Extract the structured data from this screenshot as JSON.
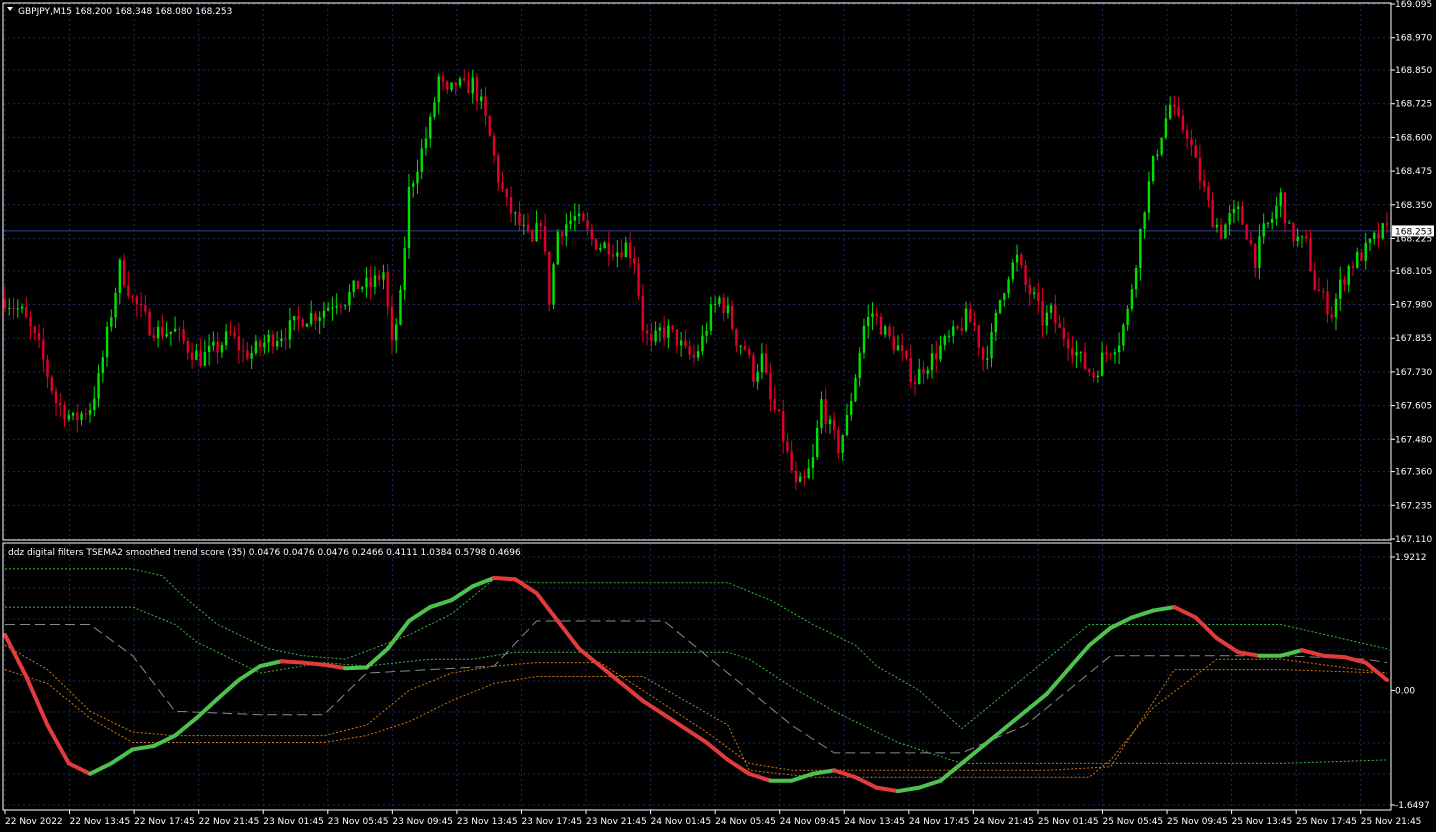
{
  "main_window": {
    "title": "GBPJPY,M15  168.200 168.348 168.080 168.253",
    "current_price": "168.253"
  },
  "indicator_window": {
    "title": "ddz digital filters TSEMA2 smoothed trend score (35) 0.0476 0.0476 0.0476 0.2466 0.4111 1.0384 0.5798 0.4696"
  },
  "colors": {
    "background": "#000000",
    "grid": "#1f2a5c",
    "frame": "#ffffff",
    "bull_candle": "#00e000",
    "bear_candle": "#e0002a",
    "score_up": "#4ec24e",
    "score_down": "#e23b3b",
    "band_green": "#3fb83f",
    "band_orange": "#d07a10",
    "band_gray": "#8a8a8a",
    "price_line": "#2f3f9a"
  },
  "chart_data": [
    {
      "type": "candlestick",
      "symbol": "GBPJPY",
      "timeframe": "M15",
      "ylim": [
        167.11,
        169.095
      ],
      "y_ticks": [
        "169.095",
        "168.970",
        "168.850",
        "168.725",
        "168.600",
        "168.475",
        "168.350",
        "168.225",
        "168.105",
        "167.980",
        "167.855",
        "167.730",
        "167.605",
        "167.480",
        "167.360",
        "167.235",
        "167.110"
      ],
      "x_ticks": [
        "22 Nov 2022",
        "22 Nov 13:45",
        "22 Nov 17:45",
        "22 Nov 21:45",
        "23 Nov 01:45",
        "23 Nov 05:45",
        "23 Nov 09:45",
        "23 Nov 13:45",
        "23 Nov 17:45",
        "23 Nov 21:45",
        "24 Nov 01:45",
        "24 Nov 05:45",
        "24 Nov 09:45",
        "24 Nov 13:45",
        "24 Nov 17:45",
        "24 Nov 21:45",
        "25 Nov 01:45",
        "25 Nov 05:45",
        "25 Nov 09:45",
        "25 Nov 13:45",
        "25 Nov 17:45",
        "25 Nov 21:45"
      ],
      "last_close": 168.253,
      "close_path": [
        [
          0,
          168.0
        ],
        [
          4,
          167.95
        ],
        [
          8,
          167.82
        ],
        [
          12,
          167.62
        ],
        [
          16,
          167.55
        ],
        [
          20,
          167.6
        ],
        [
          22,
          167.7
        ],
        [
          25,
          167.95
        ],
        [
          27,
          168.12
        ],
        [
          30,
          168.0
        ],
        [
          34,
          167.9
        ],
        [
          36,
          167.88
        ],
        [
          40,
          167.88
        ],
        [
          43,
          167.82
        ],
        [
          46,
          167.78
        ],
        [
          50,
          167.82
        ],
        [
          53,
          167.87
        ],
        [
          56,
          167.8
        ],
        [
          58,
          167.8
        ],
        [
          62,
          167.85
        ],
        [
          66,
          167.88
        ],
        [
          70,
          167.93
        ],
        [
          74,
          167.95
        ],
        [
          78,
          168.0
        ],
        [
          80,
          168.0
        ],
        [
          83,
          168.05
        ],
        [
          86,
          168.05
        ],
        [
          89,
          168.1
        ],
        [
          91,
          167.82
        ],
        [
          93,
          168.0
        ],
        [
          95,
          168.4
        ],
        [
          98,
          168.55
        ],
        [
          100,
          168.65
        ],
        [
          102,
          168.82
        ],
        [
          104,
          168.75
        ],
        [
          106,
          168.8
        ],
        [
          108,
          168.78
        ],
        [
          110,
          168.8
        ],
        [
          112,
          168.72
        ],
        [
          114,
          168.6
        ],
        [
          116,
          168.45
        ],
        [
          118,
          168.35
        ],
        [
          120,
          168.3
        ],
        [
          122,
          168.25
        ],
        [
          124,
          168.2
        ],
        [
          126,
          168.3
        ],
        [
          128,
          168.0
        ],
        [
          130,
          168.25
        ],
        [
          132,
          168.28
        ],
        [
          134,
          168.3
        ],
        [
          136,
          168.27
        ],
        [
          138,
          168.22
        ],
        [
          140,
          168.2
        ],
        [
          142,
          168.2
        ],
        [
          144,
          168.18
        ],
        [
          146,
          168.2
        ],
        [
          148,
          168.15
        ],
        [
          150,
          167.9
        ],
        [
          152,
          167.82
        ],
        [
          154,
          167.88
        ],
        [
          156,
          167.88
        ],
        [
          158,
          167.85
        ],
        [
          160,
          167.8
        ],
        [
          162,
          167.78
        ],
        [
          164,
          167.85
        ],
        [
          166,
          167.95
        ],
        [
          168,
          168.0
        ],
        [
          170,
          167.95
        ],
        [
          172,
          167.85
        ],
        [
          174,
          167.82
        ],
        [
          176,
          167.72
        ],
        [
          178,
          167.78
        ],
        [
          180,
          167.62
        ],
        [
          182,
          167.55
        ],
        [
          184,
          167.42
        ],
        [
          186,
          167.3
        ],
        [
          188,
          167.32
        ],
        [
          190,
          167.4
        ],
        [
          192,
          167.62
        ],
        [
          194,
          167.52
        ],
        [
          196,
          167.45
        ],
        [
          198,
          167.55
        ],
        [
          200,
          167.72
        ],
        [
          202,
          167.9
        ],
        [
          204,
          167.95
        ],
        [
          206,
          167.9
        ],
        [
          208,
          167.85
        ],
        [
          210,
          167.82
        ],
        [
          212,
          167.75
        ],
        [
          214,
          167.7
        ],
        [
          216,
          167.75
        ],
        [
          218,
          167.78
        ],
        [
          220,
          167.82
        ],
        [
          222,
          167.85
        ],
        [
          224,
          167.88
        ],
        [
          226,
          167.93
        ],
        [
          228,
          167.9
        ],
        [
          230,
          167.78
        ],
        [
          232,
          167.85
        ],
        [
          234,
          168.0
        ],
        [
          236,
          168.1
        ],
        [
          238,
          168.15
        ],
        [
          240,
          168.05
        ],
        [
          242,
          168.0
        ],
        [
          244,
          167.92
        ],
        [
          246,
          167.95
        ],
        [
          248,
          167.88
        ],
        [
          250,
          167.85
        ],
        [
          252,
          167.8
        ],
        [
          254,
          167.75
        ],
        [
          256,
          167.72
        ],
        [
          258,
          167.78
        ],
        [
          260,
          167.82
        ],
        [
          262,
          167.85
        ],
        [
          264,
          167.95
        ],
        [
          266,
          168.15
        ],
        [
          268,
          168.35
        ],
        [
          270,
          168.5
        ],
        [
          272,
          168.62
        ],
        [
          274,
          168.72
        ],
        [
          276,
          168.65
        ],
        [
          278,
          168.62
        ],
        [
          280,
          168.5
        ],
        [
          282,
          168.4
        ],
        [
          284,
          168.3
        ],
        [
          286,
          168.25
        ],
        [
          288,
          168.3
        ],
        [
          290,
          168.32
        ],
        [
          292,
          168.25
        ],
        [
          294,
          168.15
        ],
        [
          296,
          168.25
        ],
        [
          298,
          168.3
        ],
        [
          300,
          168.38
        ],
        [
          302,
          168.25
        ],
        [
          304,
          168.22
        ],
        [
          306,
          168.2
        ],
        [
          308,
          168.05
        ],
        [
          310,
          168.0
        ],
        [
          312,
          167.95
        ],
        [
          314,
          168.05
        ],
        [
          316,
          168.12
        ],
        [
          318,
          168.15
        ],
        [
          320,
          168.18
        ],
        [
          322,
          168.22
        ],
        [
          324,
          168.25
        ]
      ]
    },
    {
      "type": "line",
      "title": "ddz digital filters TSEMA2 smoothed trend score (35)",
      "ylim": [
        -1.6497,
        1.9212
      ],
      "y_ticks": [
        "1.9212",
        "0.00",
        "-1.6497"
      ],
      "series": [
        {
          "role": "score",
          "x": [
            0,
            5,
            10,
            15,
            20,
            25,
            30,
            35,
            40,
            45,
            50,
            55,
            60,
            65,
            70,
            75,
            80,
            85,
            90,
            95,
            100,
            105,
            110,
            115,
            120,
            125,
            130,
            135,
            140,
            145,
            150,
            155,
            160,
            165,
            170,
            175,
            180,
            185,
            190,
            195,
            200,
            205,
            210,
            215,
            220,
            225,
            230,
            235,
            240,
            245,
            250,
            255,
            260,
            265,
            270,
            275,
            280,
            285,
            290,
            295,
            300,
            305,
            310,
            315,
            320,
            325
          ],
          "y": [
            0.8,
            0.2,
            -0.5,
            -1.05,
            -1.2,
            -1.05,
            -0.85,
            -0.8,
            -0.65,
            -0.4,
            -0.12,
            0.15,
            0.35,
            0.42,
            0.4,
            0.37,
            0.32,
            0.33,
            0.6,
            1.0,
            1.2,
            1.3,
            1.5,
            1.62,
            1.6,
            1.4,
            1.0,
            0.6,
            0.35,
            0.1,
            -0.15,
            -0.35,
            -0.55,
            -0.75,
            -1.0,
            -1.2,
            -1.3,
            -1.3,
            -1.2,
            -1.15,
            -1.25,
            -1.4,
            -1.45,
            -1.4,
            -1.3,
            -1.05,
            -0.8,
            -0.55,
            -0.3,
            -0.05,
            0.3,
            0.65,
            0.9,
            1.05,
            1.15,
            1.2,
            1.05,
            0.75,
            0.55,
            0.5,
            0.5,
            0.58,
            0.5,
            0.48,
            0.4,
            0.15
          ]
        },
        {
          "role": "upper_band_1",
          "x": [
            0,
            30,
            37,
            42,
            50,
            62,
            70,
            80,
            95,
            105,
            115,
            125,
            130,
            140,
            170,
            180,
            190,
            200,
            205,
            215,
            225,
            255,
            300,
            325
          ],
          "y": [
            1.75,
            1.75,
            1.65,
            1.35,
            0.95,
            0.6,
            0.5,
            0.45,
            0.8,
            1.1,
            1.6,
            1.55,
            1.55,
            1.55,
            1.55,
            1.3,
            0.95,
            0.65,
            0.35,
            0.0,
            -0.55,
            0.95,
            0.95,
            0.6
          ]
        },
        {
          "role": "upper_band_2",
          "x": [
            0,
            30,
            40,
            45,
            60,
            75,
            85,
            100,
            110,
            120,
            140,
            150,
            170,
            175,
            185,
            195,
            210,
            215,
            225,
            240,
            255,
            300,
            325
          ],
          "y": [
            1.2,
            1.2,
            0.95,
            0.7,
            0.25,
            0.4,
            0.35,
            0.45,
            0.45,
            0.55,
            0.55,
            0.55,
            0.55,
            0.45,
            0.05,
            -0.3,
            -0.75,
            -0.85,
            -1.05,
            -1.05,
            -1.05,
            -1.05,
            -1.0
          ]
        },
        {
          "role": "gray_band",
          "x": [
            0,
            10,
            20,
            30,
            40,
            60,
            75,
            85,
            100,
            115,
            125,
            140,
            155,
            165,
            175,
            185,
            195,
            210,
            225,
            240,
            260,
            275,
            290,
            300,
            320,
            325
          ],
          "y": [
            0.95,
            0.95,
            0.95,
            0.5,
            -0.3,
            -0.35,
            -0.35,
            0.25,
            0.3,
            0.35,
            1.0,
            1.0,
            1.0,
            0.5,
            0.0,
            -0.5,
            -0.9,
            -0.9,
            -0.9,
            -0.5,
            0.5,
            0.5,
            0.5,
            0.5,
            0.45,
            0.4
          ]
        },
        {
          "role": "lower_band_1",
          "x": [
            0,
            10,
            20,
            30,
            40,
            50,
            60,
            75,
            85,
            95,
            105,
            115,
            125,
            140,
            165,
            175,
            185,
            200,
            215,
            230,
            245,
            260,
            275,
            300,
            325
          ],
          "y": [
            0.65,
            0.3,
            -0.3,
            -0.6,
            -0.65,
            -0.65,
            -0.65,
            -0.65,
            -0.5,
            0.0,
            0.25,
            0.35,
            0.4,
            0.4,
            -0.6,
            -1.05,
            -1.15,
            -1.15,
            -1.15,
            -1.15,
            -1.15,
            -1.1,
            0.3,
            0.3,
            0.25
          ]
        },
        {
          "role": "lower_band_2",
          "x": [
            0,
            10,
            20,
            30,
            40,
            50,
            60,
            75,
            85,
            95,
            105,
            115,
            125,
            135,
            150,
            170,
            175,
            190,
            215,
            240,
            255,
            260,
            270,
            285,
            300,
            325
          ],
          "y": [
            0.3,
            0.1,
            -0.4,
            -0.75,
            -0.75,
            -0.75,
            -0.75,
            -0.75,
            -0.65,
            -0.45,
            -0.15,
            0.1,
            0.2,
            0.2,
            0.2,
            -0.5,
            -1.15,
            -1.25,
            -1.25,
            -1.25,
            -1.25,
            -1.0,
            -0.25,
            0.45,
            0.45,
            0.25
          ]
        }
      ]
    }
  ]
}
